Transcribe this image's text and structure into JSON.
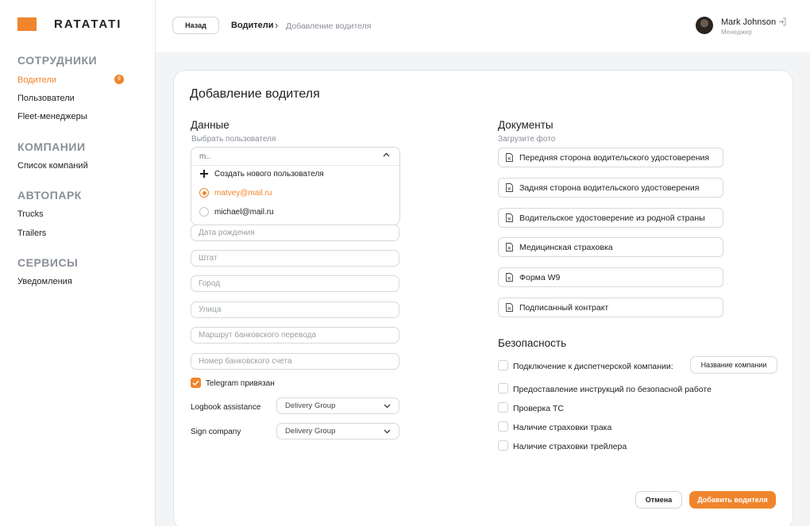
{
  "brand": {
    "name": "RATATATI",
    "accent": "#f0852d"
  },
  "sidebar": {
    "sections": [
      {
        "title": "СОТРУДНИКИ",
        "items": [
          {
            "label": "Водители",
            "badge": "9",
            "active": true
          },
          {
            "label": "Пользователи"
          },
          {
            "label": "Fleet-менеджеры"
          }
        ]
      },
      {
        "title": "КОМПАНИИ",
        "items": [
          {
            "label": "Список компаний"
          }
        ]
      },
      {
        "title": "АВТОПАРК",
        "items": [
          {
            "label": "Trucks"
          },
          {
            "label": "Trailers"
          }
        ]
      },
      {
        "title": "СЕРВИСЫ",
        "items": [
          {
            "label": "Уведомления"
          }
        ]
      }
    ]
  },
  "header": {
    "back_label": "Назад",
    "breadcrumb": [
      "Водители",
      "Добавление водителя"
    ],
    "user": {
      "name": "Mark Johnson",
      "role": "Менеджер"
    }
  },
  "form": {
    "title": "Добавление водителя",
    "data_section": {
      "title": "Данные",
      "hint": "Выбрать пользователя",
      "user_search_value": "m..",
      "options": [
        {
          "label": "Создать нового пользователя",
          "type": "create"
        },
        {
          "label": "matvey@mail.ru",
          "type": "radio",
          "selected": true
        },
        {
          "label": "michael@mail.ru",
          "type": "radio",
          "selected": false
        }
      ],
      "fields": [
        "Дата рождения",
        "Штат",
        "Город",
        "Улица",
        "Маршрут банковского перевода",
        "Номер банковского счета"
      ],
      "telegram_label": "Telegram привязан",
      "telegram_checked": true,
      "logbook_label": "Logbook assistance",
      "logbook_value": "Delivery Group",
      "sign_label": "Sign company",
      "sign_value": "Delivery Group"
    },
    "documents_section": {
      "title": "Документы",
      "hint": "Загрузите фото",
      "items": [
        "Передняя сторона водительского удостоверения",
        "Задняя сторона водительского удостоверения",
        "Водительское удостоверение из родной страны",
        "Медицинская страховка",
        "Форма W9",
        "Подписанный контракт"
      ]
    },
    "security_section": {
      "title": "Безопасность",
      "items": [
        "Подключение к диспетчерской компании:",
        "Предоставление инструкций по безопасной работе",
        "Проверка ТС",
        "Наличие страховки трака",
        "Наличие страховки трейлера"
      ],
      "company_button": "Название компании"
    },
    "cancel_label": "Отмена",
    "submit_label": "Добавить водителя"
  }
}
